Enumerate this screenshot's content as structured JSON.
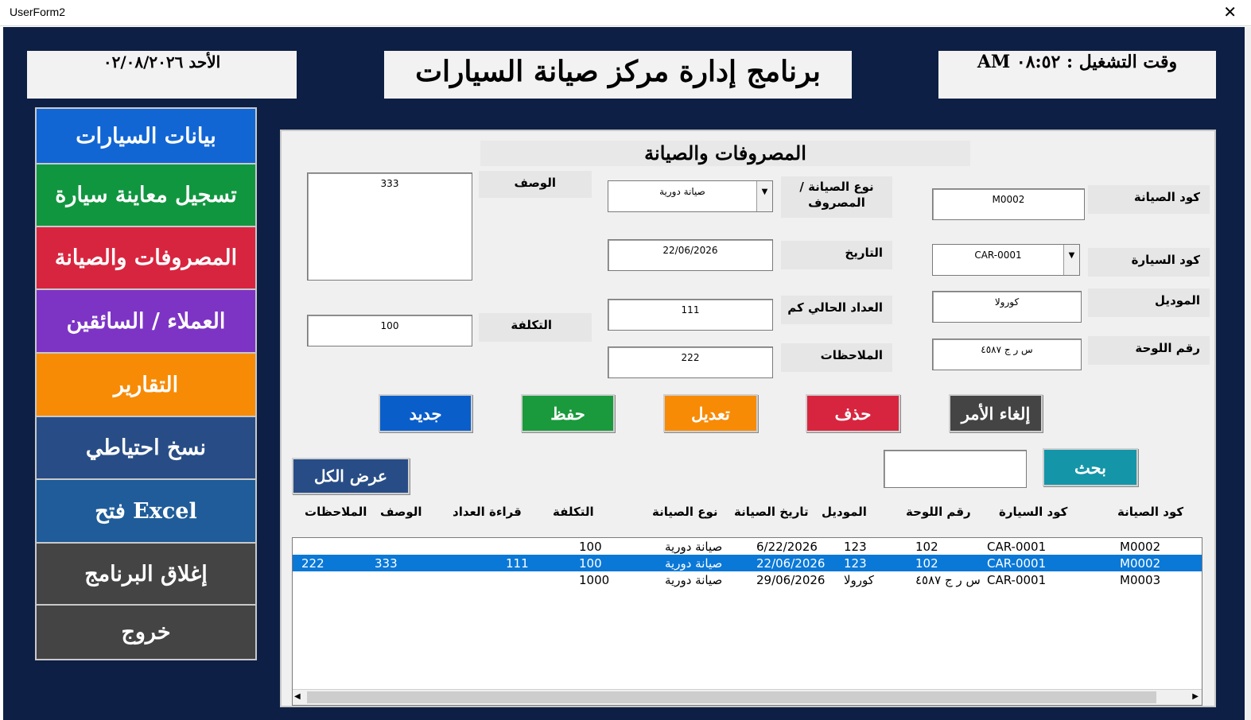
{
  "window": {
    "title": "UserForm2",
    "close_glyph": "✕"
  },
  "header": {
    "date_text": "الأحد  ٠٢/٠٨/٢٠٢٦",
    "app_title": "برنامج إدارة  مركز صيانة السيارات",
    "time_text": "وقت التشغيل : ٠٨:٥٢ AM"
  },
  "sidebar": {
    "items": [
      {
        "label": "بيانات السيارات",
        "color": "#1166d4"
      },
      {
        "label": "تسجيل معاينة سيارة",
        "color": "#119640"
      },
      {
        "label": "المصروفات والصيانة",
        "color": "#d8253f"
      },
      {
        "label": "العملاء / السائقين",
        "color": "#7d34c4"
      },
      {
        "label": "التقارير",
        "color": "#f78b06"
      },
      {
        "label": "نسخ احتياطي",
        "color": "#284d86"
      },
      {
        "label": "فتح Excel",
        "color": "#1f5c99"
      },
      {
        "label": "إغلاق البرنامج",
        "color": "#444444"
      },
      {
        "label": "خروج",
        "color": "#444444"
      }
    ]
  },
  "panel": {
    "title": "المصروفات والصيانة",
    "labels": {
      "maint_code": "كود الصيانة",
      "car_code": "كود السيارة",
      "model": "الموديل",
      "plate": "رقم اللوحة",
      "maint_type": "نوع الصيانة / المصروف",
      "date": "التاريخ",
      "odometer": "العداد الحالي كم",
      "notes": "الملاحظات",
      "description": "الوصف",
      "cost": "التكلفة"
    },
    "values": {
      "maint_code": "M0002",
      "car_code": "CAR-0001",
      "model": "كورولا",
      "plate": "س ر ج ٤٥٨٧",
      "maint_type": "صيانة دورية",
      "date": "22/06/2026",
      "odometer": "111",
      "notes": "222",
      "description": "333",
      "cost": "100"
    },
    "combo_arrow": "▼",
    "buttons": {
      "new": {
        "label": "جديد",
        "color": "#0a5ec9"
      },
      "save": {
        "label": "حفظ",
        "color": "#1a9a3c"
      },
      "edit": {
        "label": "تعديل",
        "color": "#f78b06"
      },
      "delete": {
        "label": "حذف",
        "color": "#d8253f"
      },
      "cancel": {
        "label": "إلغاء الأمر",
        "color": "#444444"
      },
      "show_all": {
        "label": "عرض الكل",
        "color": "#284d86"
      },
      "search": {
        "label": "بحث",
        "color": "#1595a8"
      }
    },
    "search_value": "",
    "columns": {
      "maint_code": "كود الصيانة",
      "car_code": "كود السيارة",
      "plate": "رقم اللوحة",
      "model": "الموديل",
      "maint_date": "تاريخ الصيانة",
      "maint_type": "نوع الصيانة",
      "cost": "التكلفة",
      "odometer_reading": "قراءة العداد",
      "description": "الوصف",
      "notes": "الملاحظات"
    },
    "rows": [
      {
        "maint_code": "M0002",
        "car_code": "CAR-0001",
        "plate": "102",
        "model": "123",
        "maint_date": "6/22/2026",
        "maint_type": "صيانة دورية",
        "cost": "100",
        "odometer": "",
        "description": "",
        "notes": "",
        "selected": false
      },
      {
        "maint_code": "M0002",
        "car_code": "CAR-0001",
        "plate": "102",
        "model": "123",
        "maint_date": "22/06/2026",
        "maint_type": "صيانة دورية",
        "cost": "100",
        "odometer": "111",
        "description": "333",
        "notes": "222",
        "selected": true
      },
      {
        "maint_code": "M0003",
        "car_code": "CAR-0001",
        "plate": "س ر ج ٤٥٨٧",
        "model": "كورولا",
        "maint_date": "29/06/2026",
        "maint_type": "صيانة دورية",
        "cost": "1000",
        "odometer": "",
        "description": "",
        "notes": "",
        "selected": false
      }
    ],
    "scroll_left": "◀",
    "scroll_right": "▶"
  }
}
